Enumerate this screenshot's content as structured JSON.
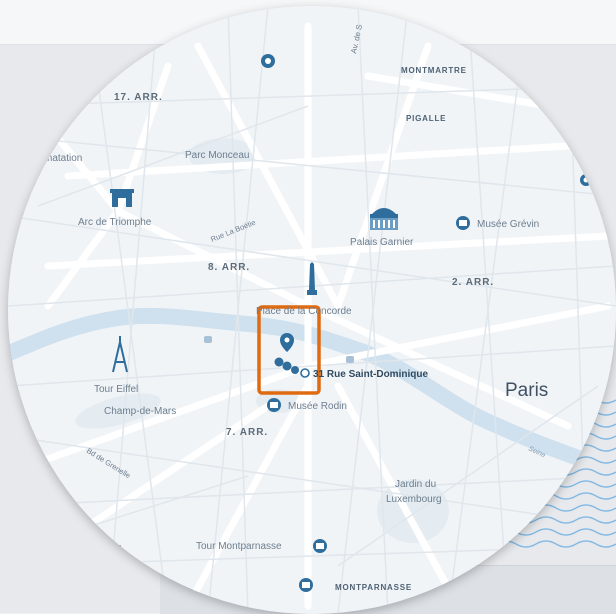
{
  "map": {
    "labels": {
      "av_de_st": "Av. de S",
      "montmartre": "MONTMARTRE",
      "arr17": "17. ARR.",
      "pigalle": "PIGALLE",
      "matation": "matation",
      "parc_monceau": "Parc Monceau",
      "arc_de_triomphe": "Arc de Triomphe",
      "rue_la_boetie": "Rue La Boétie",
      "palais_garnier": "Palais Garnier",
      "musee_grevin": "Musée Grévin",
      "arr8": "8. ARR.",
      "arr2": "2. ARR.",
      "place_concorde": "Place de la Concorde",
      "tour_eiffel": "Tour Eiffel",
      "champ_de_mars": "Champ-de-Mars",
      "address": "31 Rue Saint-Dominique",
      "paris": "Paris",
      "musee_rodin": "Musée Rodin",
      "arr7": "7. ARR.",
      "seine": "Seine",
      "bd_grenelle": "Bd de Grenelle",
      "jardin_du": "Jardin du",
      "luxembourg": "Luxembourg",
      "tour_montparnasse": "Tour Montparnasse",
      "montparnasse": "MONTPARNASSE",
      "arr_edge": "8."
    },
    "colors": {
      "water": "#cfe0ee",
      "marker": "#2f6d9c",
      "highlight": "#e06a10",
      "road": "#ffffff",
      "text": "#6d7e8e"
    }
  }
}
